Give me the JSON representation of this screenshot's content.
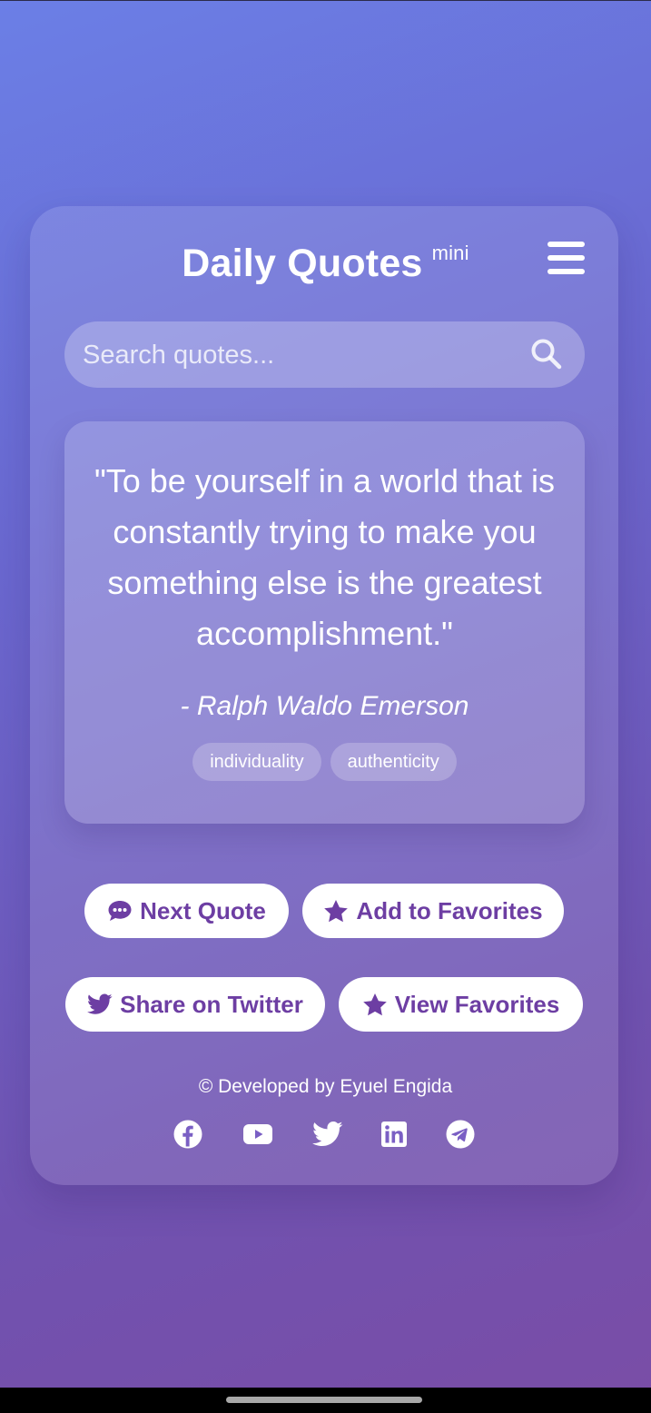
{
  "header": {
    "title": "Daily Quotes",
    "title_sup": "mini",
    "menu_icon": "hamburger-menu-icon"
  },
  "search": {
    "placeholder": "Search quotes...",
    "value": "",
    "icon": "search-icon"
  },
  "quote": {
    "text": "\"To be yourself in a world that is constantly trying to make you something else is the greatest accomplishment.\"",
    "author": "- Ralph Waldo Emerson",
    "tags": [
      "individuality",
      "authenticity"
    ]
  },
  "actions": {
    "next_quote": "Next Quote",
    "add_favorites": "Add to Favorites",
    "share_twitter": "Share on Twitter",
    "view_favorites": "View Favorites"
  },
  "footer": {
    "credit": "© Developed by Eyuel Engida",
    "social_icons": [
      "facebook-icon",
      "youtube-icon",
      "twitter-icon",
      "linkedin-icon",
      "telegram-icon"
    ]
  },
  "colors": {
    "accent": "#6d3ea3",
    "background_start": "#6b7fe6",
    "background_end": "#7a4da6"
  }
}
